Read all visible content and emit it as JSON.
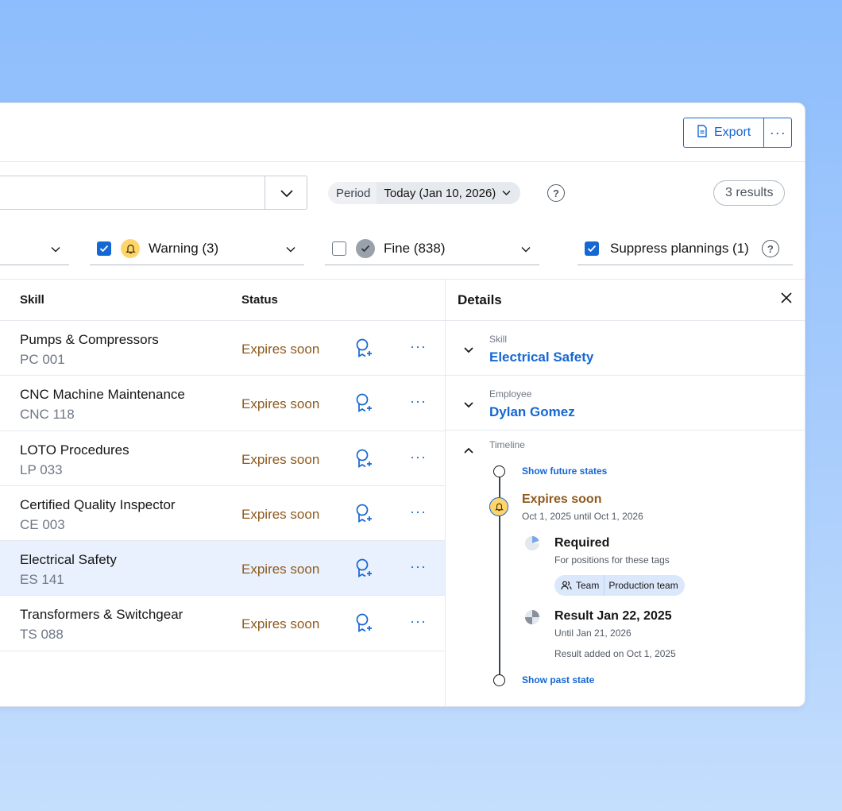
{
  "toolbar": {
    "export_label": "Export",
    "more_label": "···"
  },
  "filters": {
    "period_label": "Period",
    "period_value": "Today (Jan 10, 2026)",
    "results": "3 results",
    "warning_label": "Warning (3)",
    "fine_label": "Fine (838)",
    "suppress_label": "Suppress plannings (1)"
  },
  "table": {
    "col_skill": "Skill",
    "col_status": "Status",
    "rows": [
      {
        "name": "Pumps & Compressors",
        "code": "PC 001",
        "status": "Expires soon"
      },
      {
        "name": "CNC Machine Maintenance",
        "code": "CNC 118",
        "status": "Expires soon"
      },
      {
        "name": "LOTO Procedures",
        "code": "LP 033",
        "status": "Expires soon"
      },
      {
        "name": "Certified Quality Inspector",
        "code": "CE 003",
        "status": "Expires soon"
      },
      {
        "name": "Electrical Safety",
        "code": "ES 141",
        "status": "Expires soon"
      },
      {
        "name": "Transformers & Switchgear",
        "code": "TS 088",
        "status": "Expires soon"
      }
    ],
    "row_more": "···"
  },
  "details": {
    "title": "Details",
    "skill_label": "Skill",
    "skill_value": "Electrical Safety",
    "employee_label": "Employee",
    "employee_value": "Dylan Gomez",
    "timeline_label": "Timeline",
    "show_future": "Show future states",
    "expires_title": "Expires soon",
    "expires_range": "Oct 1, 2025 until Oct 1, 2026",
    "required_title": "Required",
    "required_sub": "For positions for these tags",
    "tag_team": "Team",
    "tag_production": "Production team",
    "result_title": "Result Jan 22, 2025",
    "result_until": "Until Jan 21, 2026",
    "result_added": "Result added on Oct 1, 2025",
    "show_past": "Show past state"
  },
  "colors": {
    "accent": "#1567d3",
    "warning": "#ffd56b",
    "status_text": "#8e5a1e",
    "selected_row": "#e8f1fd"
  }
}
